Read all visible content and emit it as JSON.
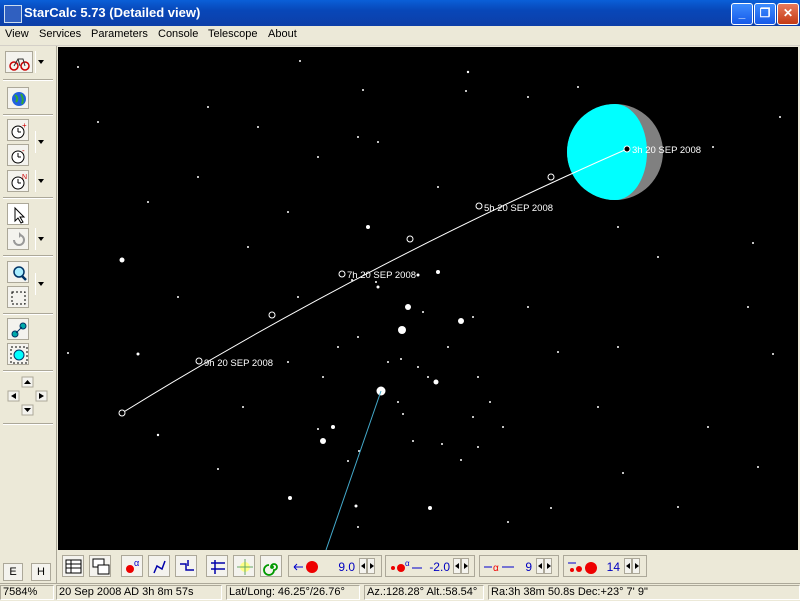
{
  "window": {
    "title": "StarCalc 5.73 (Detailed view)"
  },
  "menu": {
    "items": [
      "View",
      "Services",
      "Parameters",
      "Console",
      "Telescope",
      "About"
    ]
  },
  "left_toolbar": {
    "e_label": "E",
    "h_label": "H"
  },
  "sky": {
    "path_labels": [
      "3h 20 SEP 2008",
      "5h 20 SEP 2008",
      "7h 20 SEP 2008",
      "9h 20 SEP 2008"
    ],
    "moon_color": "#00ffff",
    "moon_shadow_color": "#808080"
  },
  "bottom_toolbar": {
    "star_mag": "9.0",
    "galaxy_mag": "-2.0",
    "label_value": "9",
    "size_value": "14"
  },
  "status": {
    "zoom": "7584%",
    "datetime": "20 Sep 2008 AD 3h 8m 57s",
    "latlong": "Lat/Long: 46.25°/26.76°",
    "azalt": "Az.:128.28° Alt.:58.54°",
    "radec": "Ra:3h 38m 50.8s Dec:+23° 7' 9\""
  }
}
